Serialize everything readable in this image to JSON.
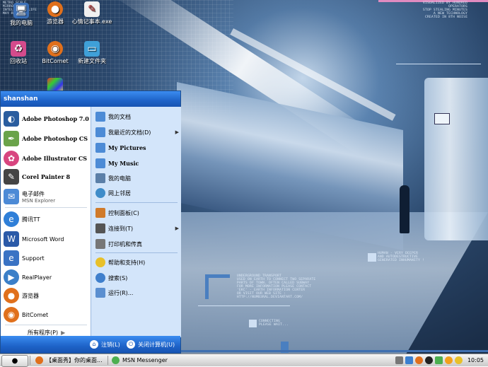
{
  "desktop": {
    "icons": [
      {
        "label": "我的电脑",
        "icon": "my-computer-icon",
        "color": "#3b6fb6"
      },
      {
        "label": "游览器",
        "icon": "firefox-icon",
        "color": "#e0701c"
      },
      {
        "label": "心情记事本.exe",
        "icon": "notepad-icon",
        "color": "#b52a2a"
      },
      {
        "label": "回收站",
        "icon": "recycle-bin-icon",
        "color": "#d44b8c"
      },
      {
        "label": "BitComet",
        "icon": "bitcomet-icon",
        "color": "#e0701c"
      },
      {
        "label": "新建文件夹",
        "icon": "folder-icon",
        "color": "#3fa0d8"
      }
    ],
    "wallpaper": {
      "top_left_text": "METRO SCALE\nMIRRORING\nINTELLIGENT LIFE\nMAY RESULT\n",
      "top_right_text": "VISUALIZED BY HUNDRED\nOPERATORS\nSTOP STEALING MINUTES\nA NEW TECHNOLOGY\nCREATED IN 8TH NOISE",
      "mid_right_text": "HUMAN - VERY DEEPER\nAND AUTODESTRUCTIVE\nGENERATED INHUMANITY !",
      "bottom_text": "UNDERGROUND TRANSPORT\nUSED ON EARTH TO CONNECT TWO SEPARATE\nPARTS OF TOWN. OFTEN CALLED SUBWAY\nFOR MORE INFORMATION PLEASE CONTACT\n'EKC' - EARTH INFORMATION CENTER\nOR VISIT OUR WEB SITE :\nHTTP://NUMB3RAL.DEVIANTART.COM/",
      "connecting_text": "CONNECTING\nPLEASE WAIT..."
    }
  },
  "start_menu": {
    "user": "shanshan",
    "left_items": [
      {
        "label": "Adobe Photoshop 7.0",
        "icon": "photoshop-icon",
        "color": "#2a5d9f",
        "bold": true
      },
      {
        "label": "Adobe Photoshop CS",
        "icon": "photoshop-cs-icon",
        "color": "#6aa34a",
        "bold": true
      },
      {
        "label": "Adobe Illustrator CS",
        "icon": "illustrator-icon",
        "color": "#d8457f",
        "bold": true
      },
      {
        "label": "Corel Painter 8",
        "icon": "painter-icon",
        "color": "#444444",
        "bold": true
      },
      {
        "label": "电子邮件",
        "sub": "MSN Explorer",
        "icon": "email-icon",
        "color": "#4c8ad6",
        "bold": false
      },
      {
        "label": "腾讯TT",
        "icon": "tencent-tt-icon",
        "color": "#2f7fd8",
        "bold": false
      },
      {
        "label": "Microsoft Word",
        "icon": "word-icon",
        "color": "#2b5aa8",
        "bold": false
      },
      {
        "label": "Support",
        "icon": "support-icon",
        "color": "#3a73c4",
        "bold": false
      },
      {
        "label": "RealPlayer",
        "icon": "realplayer-icon",
        "color": "#3b7fc8",
        "bold": false
      },
      {
        "label": "游览器",
        "icon": "firefox-icon",
        "color": "#e0701c",
        "bold": false
      },
      {
        "label": "BitComet",
        "icon": "bitcomet-icon",
        "color": "#e0701c",
        "bold": false
      }
    ],
    "all_programs": "所有程序(P)",
    "right_items": [
      {
        "label": "我的文档",
        "icon": "documents-icon",
        "color": "#4d8bd6",
        "bold": false,
        "arrow": false
      },
      {
        "label": "我最近的文档(D)",
        "icon": "recent-docs-icon",
        "color": "#4d8bd6",
        "bold": false,
        "arrow": true
      },
      {
        "label": "My Pictures",
        "icon": "pictures-icon",
        "color": "#4d8bd6",
        "bold": true,
        "arrow": false
      },
      {
        "label": "My Music",
        "icon": "music-icon",
        "color": "#4d8bd6",
        "bold": true,
        "arrow": false
      },
      {
        "label": "我的电脑",
        "icon": "my-computer-icon",
        "color": "#5b7fa8",
        "bold": false,
        "arrow": false
      },
      {
        "label": "网上邻居",
        "icon": "network-icon",
        "color": "#3f8cc9",
        "bold": false,
        "arrow": false
      },
      {
        "label": "控制面板(C)",
        "icon": "control-panel-icon",
        "color": "#d07a2a",
        "bold": false,
        "arrow": false
      },
      {
        "label": "连接到(T)",
        "icon": "connect-icon",
        "color": "#555555",
        "bold": false,
        "arrow": true
      },
      {
        "label": "打印机和传真",
        "icon": "printer-icon",
        "color": "#777777",
        "bold": false,
        "arrow": false
      },
      {
        "label": "帮助和支持(H)",
        "icon": "help-icon",
        "color": "#e8c02a",
        "bold": false,
        "arrow": false
      },
      {
        "label": "搜索(S)",
        "icon": "search-icon",
        "color": "#3f7fcc",
        "bold": false,
        "arrow": false
      },
      {
        "label": "运行(R)...",
        "icon": "run-icon",
        "color": "#5b8fd0",
        "bold": false,
        "arrow": false
      }
    ],
    "footer": {
      "logoff": "注销(L)",
      "shutdown": "关闭计算机(U)"
    }
  },
  "taskbar": {
    "tasks": [
      {
        "label": "【桌面秀】你的桌面...",
        "icon": "firefox-icon",
        "color": "#e0701c"
      },
      {
        "label": "MSN Messenger",
        "icon": "msn-icon",
        "color": "#4caf50"
      }
    ],
    "clock": "10:05"
  },
  "colors": {
    "start_menu_blue": "#1e63c8",
    "taskbar": "#dcdcdc"
  }
}
